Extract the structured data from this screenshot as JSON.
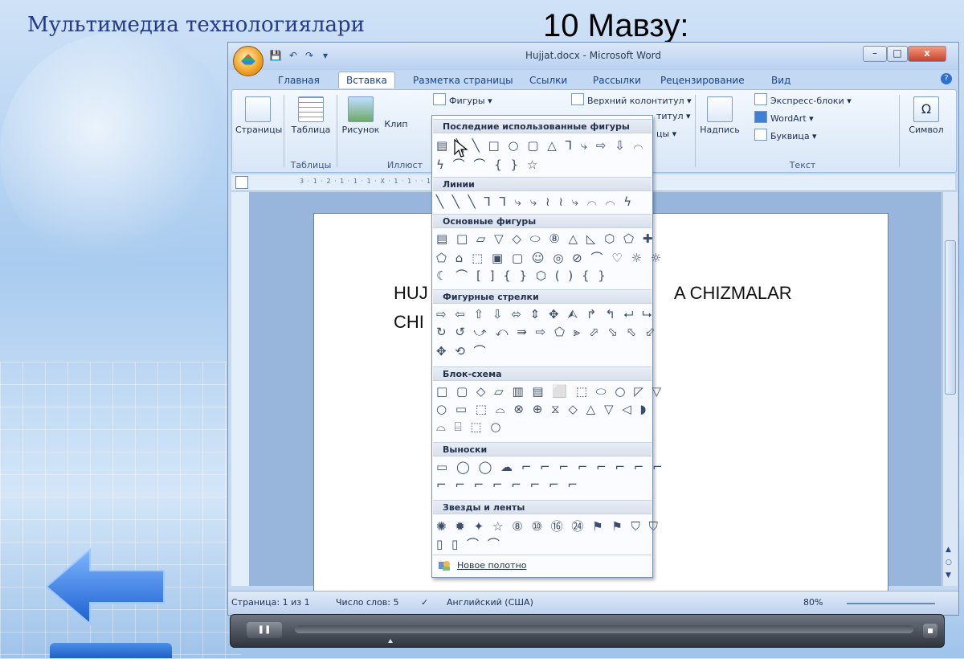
{
  "slide": {
    "title": "Мультимедиа технологиялари",
    "topic": "10 Мавзу:"
  },
  "word": {
    "window_title": "Hujjat.docx - Microsoft Word",
    "qat": {
      "save": "💾",
      "undo": "↶",
      "redo": "↷",
      "more": "▾"
    },
    "window_buttons": {
      "minimize": "–",
      "maximize": "□",
      "close": "x"
    },
    "tabs": [
      "Главная",
      "Вставка",
      "Разметка страницы",
      "Ссылки",
      "Рассылки",
      "Рецензирование",
      "Вид"
    ],
    "active_tab": "Вставка",
    "ribbon": {
      "pages": "Страницы",
      "table": "Таблица",
      "tables_group": "Таблицы",
      "picture": "Рисунок",
      "clip": "Клип",
      "illustrations_group": "Иллюст",
      "shapes": "Фигуры ▾",
      "header": "Верхний колонтитул ▾",
      "footer_partial": "титул ▾",
      "pagenum_partial": "цы ▾",
      "textbox": "Надпись",
      "quickparts": "Экспресс-блоки ▾",
      "wordart": "WordArt ▾",
      "dropcap": "Буквица ▾",
      "text_group": "Текст",
      "symbol": "Символ"
    },
    "ruler_text": "3 · 1 · 2 · 1 · 1 · 1 · X · 1 · 1 ·                                                        · 10 · · 11 · · 12 · · 13 · · 14 ·  · 15 · · 16 · △ 17 · ·",
    "document": {
      "line1_start": "HUJ",
      "line1_end": "A CHIZMALAR",
      "line2_start": "CHI"
    },
    "status": {
      "page": "Страница: 1 из 1",
      "words": "Число слов: 5",
      "language": "Английский (США)",
      "zoom": "80%"
    }
  },
  "shapes_menu": {
    "recent_header": "Последние использованные фигуры",
    "recent_row1": "▤ ╲ ╲ □ ○ ▢ △ ⅂ ⤷ ⇨ ⇩ ⌒",
    "recent_row2": "ϟ ⌒ ⌒ { } ☆",
    "lines_header": "Линии",
    "lines_row": "╲ ╲ ╲ ⅂ ⅂ ⤷ ⤷ ≀ ≀ ⤷ ⌒ ⌒ ϟ",
    "basic_header": "Основные фигуры",
    "basic_row1": "▤ □ ▱ ▽ ◇ ⬭ ⑧ △ ◺ ⬡ ⬠ ✚",
    "basic_row2": "⬠ ⌂ ⬚ ▣ ▢ ☺ ◎ ⊘ ⌒ ♡ ☼ ☼",
    "basic_row3": "☾ ⌒ [ ] { } ⬡ ( ) { }",
    "arrows_header": "Фигурные стрелки",
    "arrows_row1": "⇨ ⇦ ⇧ ⇩ ⬄ ⇕ ✥ ⮙ ↱ ↰ ⮠ ⮡",
    "arrows_row2": "↻ ↺ ⤻ ⤺ ⇛ ⇨ ⬠ ⪢ ⬀ ⬂ ⬁ ⬃",
    "arrows_row3": "✥ ⟲ ⌒",
    "flowchart_header": "Блок-схема",
    "flowchart_row1": "□ ▢ ◇ ▱ ▥ ▤ ⬜ ⬚ ⬭ ○ ◸ ▽",
    "flowchart_row2": "○ ▭ ⬚ ⌓ ⊗ ⊕ ⧖ ◇ △ ▽ ◁ ◗",
    "flowchart_row3": "⌓ ⌸ ⬚ ○",
    "callouts_header": "Выноски",
    "callouts_row1": "▭ ◯ ◯ ☁ ⌐ ⌐ ⌐ ⌐ ⌐ ⌐ ⌐ ⌐",
    "callouts_row2": "⌐ ⌐ ⌐ ⌐ ⌐ ⌐ ⌐ ⌐",
    "stars_header": "Звезды и ленты",
    "stars_row1": "✺ ✹ ✦ ☆ ⑧ ⑩ ⑯ ㉔ ⚑ ⚑ ⛉ ⛉",
    "stars_row2": "▯ ▯ ⌒ ⌒",
    "new_canvas": "Новое полотно"
  },
  "player": {
    "pause": "❚❚"
  },
  "colors": {
    "slide_title": "#243a8c",
    "arrow": "#2f7be0",
    "ribbon_text": "#15428b"
  }
}
